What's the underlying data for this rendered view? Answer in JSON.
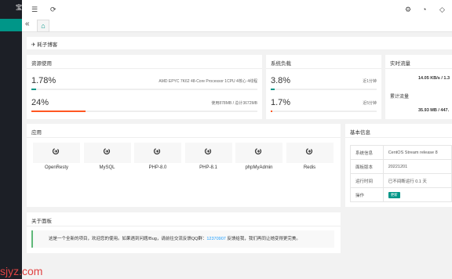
{
  "sidebar": {
    "brand": "宝"
  },
  "header": {
    "title": "耗子博客"
  },
  "resource": {
    "title": "资源使用",
    "cpu_percent": "1.78%",
    "cpu_info": "AMD EPYC 7K62 48-Core Processor 1CPU 4核心 4线程",
    "cpu_fill": 0.02,
    "mem_percent": "24%",
    "mem_info": "使用878MB / 总计3672MB",
    "mem_fill": 0.24,
    "cpu_color": "#009688",
    "mem_color": "#ff5722"
  },
  "load": {
    "title": "系统负载",
    "load1": "3.8%",
    "load1_label": "近1分钟",
    "load1_fill": 0.038,
    "load5": "1.7%",
    "load5_label": "近5分钟",
    "load5_fill": 0.017,
    "load1_color": "#009688",
    "load5_color": "#ff5722"
  },
  "traffic": {
    "title": "实时流量",
    "rate": "14.05 KB/s / 1.3",
    "total_label": "累计流量",
    "total": "35.93 MB / 447."
  },
  "apps": {
    "title": "应用",
    "items": [
      {
        "label": "OpenResty"
      },
      {
        "label": "MySQL"
      },
      {
        "label": "PHP-8.0"
      },
      {
        "label": "PHP-8.1"
      },
      {
        "label": "phpMyAdmin"
      },
      {
        "label": "Redis"
      }
    ]
  },
  "info": {
    "title": "基本信息",
    "rows": [
      {
        "key": "系统信息",
        "value": "CentOS Stream release 8"
      },
      {
        "key": "面板版本",
        "value": "20221201"
      },
      {
        "key": "运行时间",
        "value": "已不间断运行 0.1 天"
      },
      {
        "key": "操作",
        "button": "更新"
      }
    ]
  },
  "about": {
    "title": "关于面板",
    "text_before": "这是一个全新的项目，欢迎您的使用。如果遇到问题/Bug，请前往交流反馈QQ群：",
    "qq": "12370907",
    "text_after": " 反馈给我，我们再同让她变得更完美。"
  },
  "watermark": "sjyz.com"
}
